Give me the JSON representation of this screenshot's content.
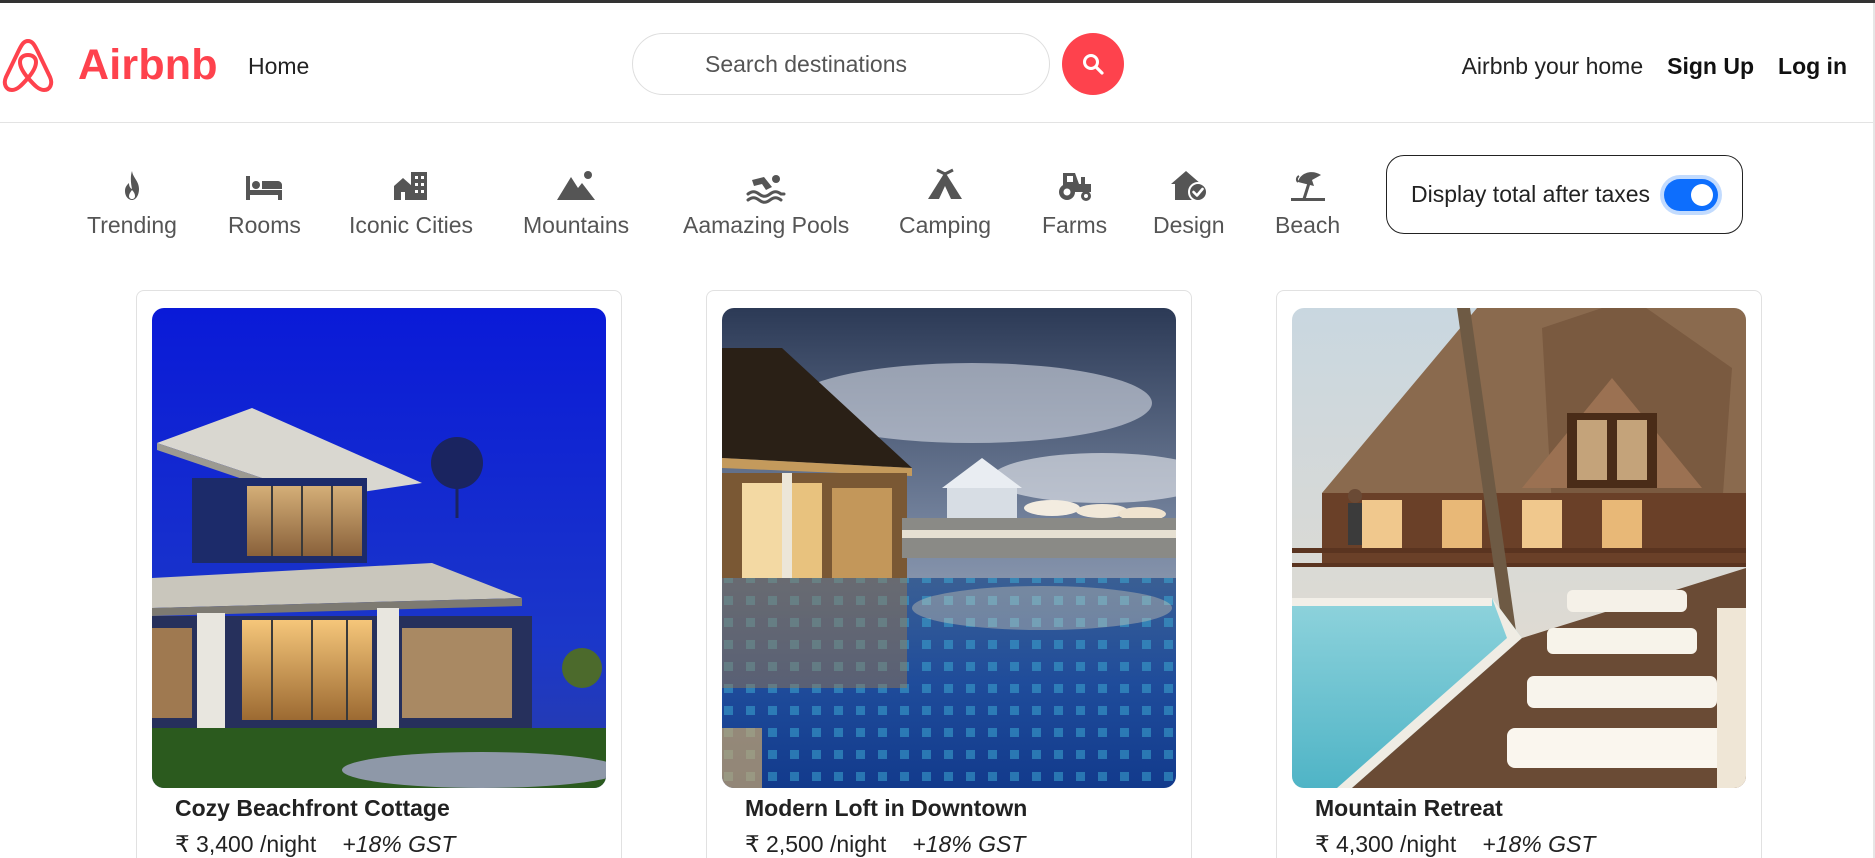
{
  "brand": {
    "name": "Airbnb",
    "color": "#fe424d"
  },
  "nav": {
    "home": "Home",
    "search_placeholder": "Search destinations",
    "airbnb_your_home": "Airbnb your home",
    "sign_up": "Sign Up",
    "log_in": "Log in"
  },
  "filters": [
    {
      "label": "Trending",
      "icon": "fire-icon"
    },
    {
      "label": "Rooms",
      "icon": "bed-icon"
    },
    {
      "label": "Iconic Cities",
      "icon": "city-icon"
    },
    {
      "label": "Mountains",
      "icon": "mountain-icon"
    },
    {
      "label": "Aamazing Pools",
      "icon": "swimmer-icon"
    },
    {
      "label": "Camping",
      "icon": "tent-icon"
    },
    {
      "label": "Farms",
      "icon": "tractor-icon"
    },
    {
      "label": "Design",
      "icon": "house-check-icon"
    },
    {
      "label": "Beach",
      "icon": "umbrella-beach-icon"
    }
  ],
  "tax_toggle": {
    "label": "Display total after taxes",
    "checked": true,
    "accent": "#0d6efd"
  },
  "listings": [
    {
      "title": "Cozy Beachfront Cottage",
      "price": "₹ 3,400 /night",
      "tax_note": "+18% GST"
    },
    {
      "title": "Modern Loft in Downtown",
      "price": "₹ 2,500 /night",
      "tax_note": "+18% GST"
    },
    {
      "title": "Mountain Retreat",
      "price": "₹ 4,300 /night",
      "tax_note": "+18% GST"
    }
  ]
}
